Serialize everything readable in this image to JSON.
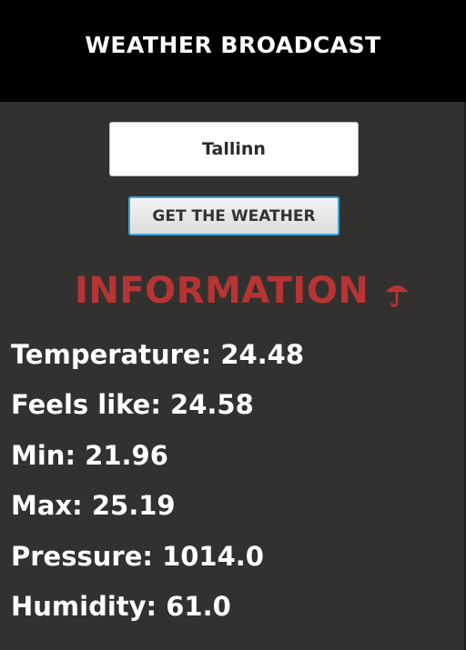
{
  "header": {
    "title": "WEATHER BROADCAST"
  },
  "search": {
    "value": "Tallinn"
  },
  "button": {
    "label": "GET THE WEATHER"
  },
  "info": {
    "heading": "INFORMATION",
    "icon": "umbrella-icon",
    "icon_color": "#b83434",
    "rows": [
      {
        "label": "Temperature:",
        "value": "24.48"
      },
      {
        "label": "Feels like:",
        "value": "24.58"
      },
      {
        "label": "Min:",
        "value": "21.96"
      },
      {
        "label": "Max:",
        "value": "25.19"
      },
      {
        "label": "Pressure:",
        "value": "1014.0"
      },
      {
        "label": "Humidity:",
        "value": "61.0"
      }
    ]
  },
  "colors": {
    "background": "#323130",
    "header_background": "#000000",
    "accent": "#b83434",
    "button_border": "#39a7d8"
  }
}
